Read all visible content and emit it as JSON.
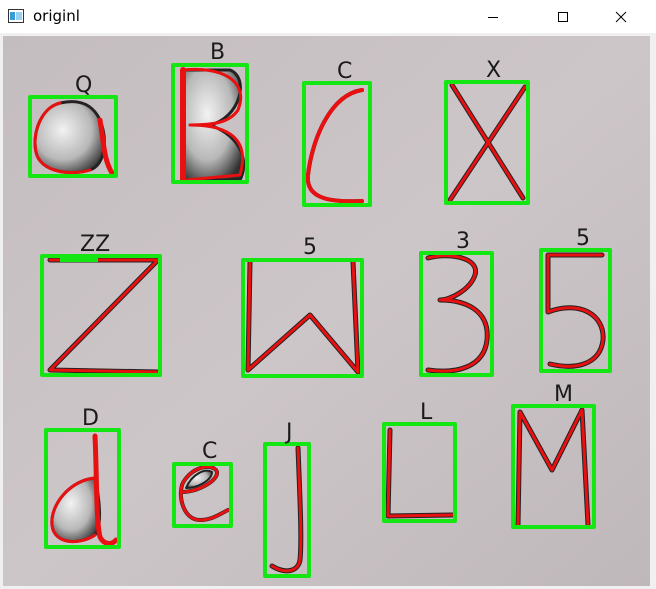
{
  "window": {
    "title": "originl",
    "icon": "opencv-window-icon"
  },
  "controls": {
    "minimize_icon": "minimize-icon",
    "maximize_icon": "maximize-icon",
    "close_icon": "close-icon"
  },
  "colors": {
    "paper": "#c9c2c4",
    "box": "#14e614",
    "stroke": "#e81010",
    "ink": "#202020"
  },
  "detections": [
    {
      "label": "Q"
    },
    {
      "label": "B"
    },
    {
      "label": "C"
    },
    {
      "label": "X"
    },
    {
      "label": "ZZ"
    },
    {
      "label": "5"
    },
    {
      "label": "3"
    },
    {
      "label": "5"
    },
    {
      "label": "D"
    },
    {
      "label": "C"
    },
    {
      "label": "J"
    },
    {
      "label": "L"
    },
    {
      "label": "M"
    }
  ]
}
